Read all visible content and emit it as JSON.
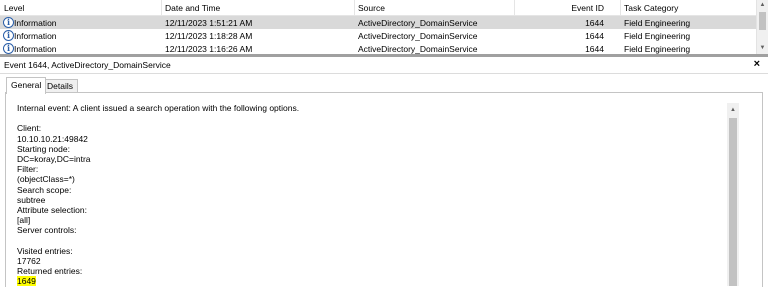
{
  "list": {
    "columns": [
      "Level",
      "Date and Time",
      "Source",
      "Event ID",
      "Task Category"
    ],
    "rows": [
      {
        "level": "Information",
        "date": "12/11/2023 1:51:21 AM",
        "source": "ActiveDirectory_DomainService",
        "id": "1644",
        "task": "Field Engineering",
        "selected": true
      },
      {
        "level": "Information",
        "date": "12/11/2023 1:18:28 AM",
        "source": "ActiveDirectory_DomainService",
        "id": "1644",
        "task": "Field Engineering",
        "selected": false
      },
      {
        "level": "Information",
        "date": "12/11/2023 1:16:26 AM",
        "source": "ActiveDirectory_DomainService",
        "id": "1644",
        "task": "Field Engineering",
        "selected": false
      }
    ]
  },
  "details": {
    "title": "Event 1644, ActiveDirectory_DomainService",
    "close_icon": "×",
    "tabs": [
      "General",
      "Details"
    ],
    "active_tab": "General",
    "lines": [
      "Internal event: A client issued a search operation with the following options.",
      "",
      "Client:",
      "10.10.10.21:49842",
      "Starting node:",
      "DC=koray,DC=intra",
      "Filter:",
      " (objectClass=*)",
      "Search scope:",
      "subtree",
      "Attribute selection:",
      "[all]",
      "Server controls:",
      "",
      "Visited entries:",
      "17762",
      "Returned entries:",
      "1649"
    ],
    "highlighted_line_index": 17,
    "highlight_color": "#ffff00"
  },
  "colors": {
    "selected_row": "#d9d9d9",
    "info_icon": "#2a5ea8"
  }
}
